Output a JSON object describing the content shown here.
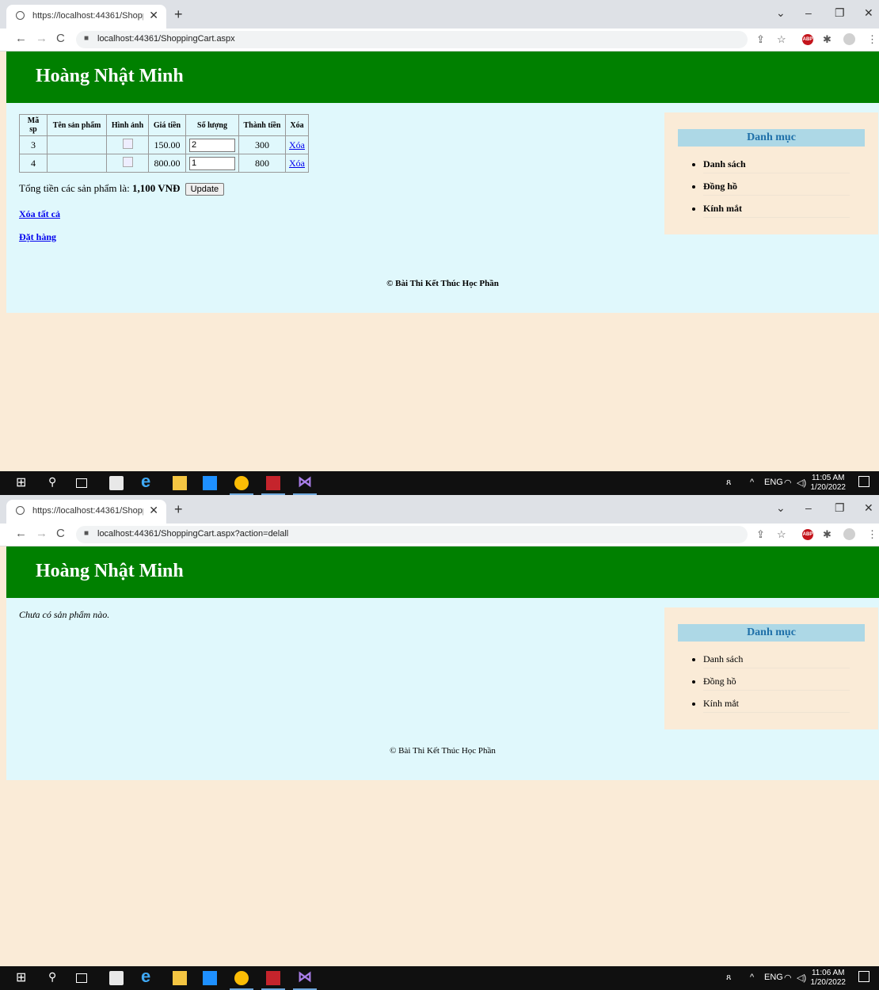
{
  "browser": {
    "tab1_title": "https://localhost:44361/Shoppin",
    "tab2_title": "https://localhost:44361/Shoppin",
    "url1": "localhost:44361/ShoppingCart.aspx",
    "url2": "localhost:44361/ShoppingCart.aspx?action=delall"
  },
  "site": {
    "title": "Hoàng Nhật Minh",
    "footer": "© Bài Thi Kết Thúc Học Phần"
  },
  "cart": {
    "headers": [
      "Mã sp",
      "Tên sản phẩm",
      "Hình ảnh",
      "Giá tiền",
      "Số lượng",
      "Thành tiền",
      "Xóa"
    ],
    "rows": [
      {
        "id": "3",
        "name": "",
        "price": "150.00",
        "qty": "2",
        "total": "300",
        "delete": "Xóa"
      },
      {
        "id": "4",
        "name": "",
        "price": "800.00",
        "qty": "1",
        "total": "800",
        "delete": "Xóa"
      }
    ],
    "total_prefix": "Tổng tiền các sản phẩm là:",
    "total_value": "1,100 VNĐ",
    "update_label": "Update",
    "clear_all": "Xóa tất cả",
    "checkout": "Đặt hàng",
    "empty_message": "Chưa có sản phẩm nào."
  },
  "sidebar": {
    "title": "Danh mục",
    "items": [
      "Danh sách",
      "Đồng hồ",
      "Kính mắt"
    ]
  },
  "taskbar": {
    "time1": "11:05 AM",
    "date1": "1/20/2022",
    "time2": "11:06 AM",
    "date2": "1/20/2022",
    "input_indicator": "ENG"
  },
  "colors": {
    "header_green": "#008000",
    "content_bg": "#e0f8fc",
    "sidebar_bg": "#faebd7",
    "sidebar_title_bg": "#add8e6"
  }
}
